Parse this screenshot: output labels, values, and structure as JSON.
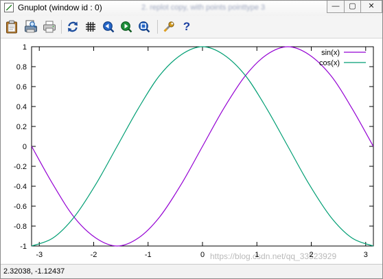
{
  "window": {
    "title": "Gnuplot (window id : 0)",
    "background_text": "2. replot copy, with points pointtype 3",
    "controls": {
      "minimize": "—",
      "maximize": "▢",
      "close": "✕"
    }
  },
  "toolbar": {
    "icons": [
      "clipboard-icon",
      "print-preview-icon",
      "printer-icon",
      "replot-icon",
      "grid-icon",
      "zoom-previous-icon",
      "zoom-next-icon",
      "zoom-autoscale-icon",
      "options-wrench-icon",
      "help-icon"
    ],
    "help_label": "?"
  },
  "status": {
    "coordinates": "2.32038, -1.12437"
  },
  "watermark": "https://blog.csdn.net/qq_33523929",
  "chart_data": {
    "type": "line",
    "title": "",
    "xlabel": "",
    "ylabel": "",
    "xlim": [
      -3.14159,
      3.14159
    ],
    "ylim": [
      -1,
      1
    ],
    "x_ticks": [
      -3,
      -2,
      -1,
      0,
      1,
      2,
      3
    ],
    "x_tick_labels": [
      "-3",
      "-2",
      "-1",
      "0",
      "1",
      "2",
      "3"
    ],
    "y_ticks": [
      -1,
      -0.8,
      -0.6,
      -0.4,
      -0.2,
      0,
      0.2,
      0.4,
      0.6,
      0.8,
      1
    ],
    "y_tick_labels": [
      "-1",
      "-0.8",
      "-0.6",
      "-0.4",
      "-0.2",
      "0",
      "0.2",
      "0.4",
      "0.6",
      "0.8",
      "1"
    ],
    "grid": false,
    "legend_position": "top-right",
    "series": [
      {
        "name": "sin(x)",
        "color": "#9400d3",
        "x": [
          -3.14,
          -2.75,
          -2.36,
          -1.96,
          -1.57,
          -1.18,
          -0.79,
          -0.39,
          0,
          0.39,
          0.79,
          1.18,
          1.57,
          1.96,
          2.36,
          2.75,
          3.14
        ],
        "y": [
          0,
          -0.38,
          -0.71,
          -0.92,
          -1,
          -0.92,
          -0.71,
          -0.38,
          0,
          0.38,
          0.71,
          0.92,
          1,
          0.92,
          0.71,
          0.38,
          0
        ]
      },
      {
        "name": "cos(x)",
        "color": "#009e73",
        "x": [
          -3.14,
          -2.75,
          -2.36,
          -1.96,
          -1.57,
          -1.18,
          -0.79,
          -0.39,
          0,
          0.39,
          0.79,
          1.18,
          1.57,
          1.96,
          2.36,
          2.75,
          3.14
        ],
        "y": [
          -1,
          -0.92,
          -0.71,
          -0.38,
          0,
          0.38,
          0.71,
          0.92,
          1,
          0.92,
          0.71,
          0.38,
          0,
          -0.38,
          -0.71,
          -0.92,
          -1
        ]
      }
    ]
  }
}
